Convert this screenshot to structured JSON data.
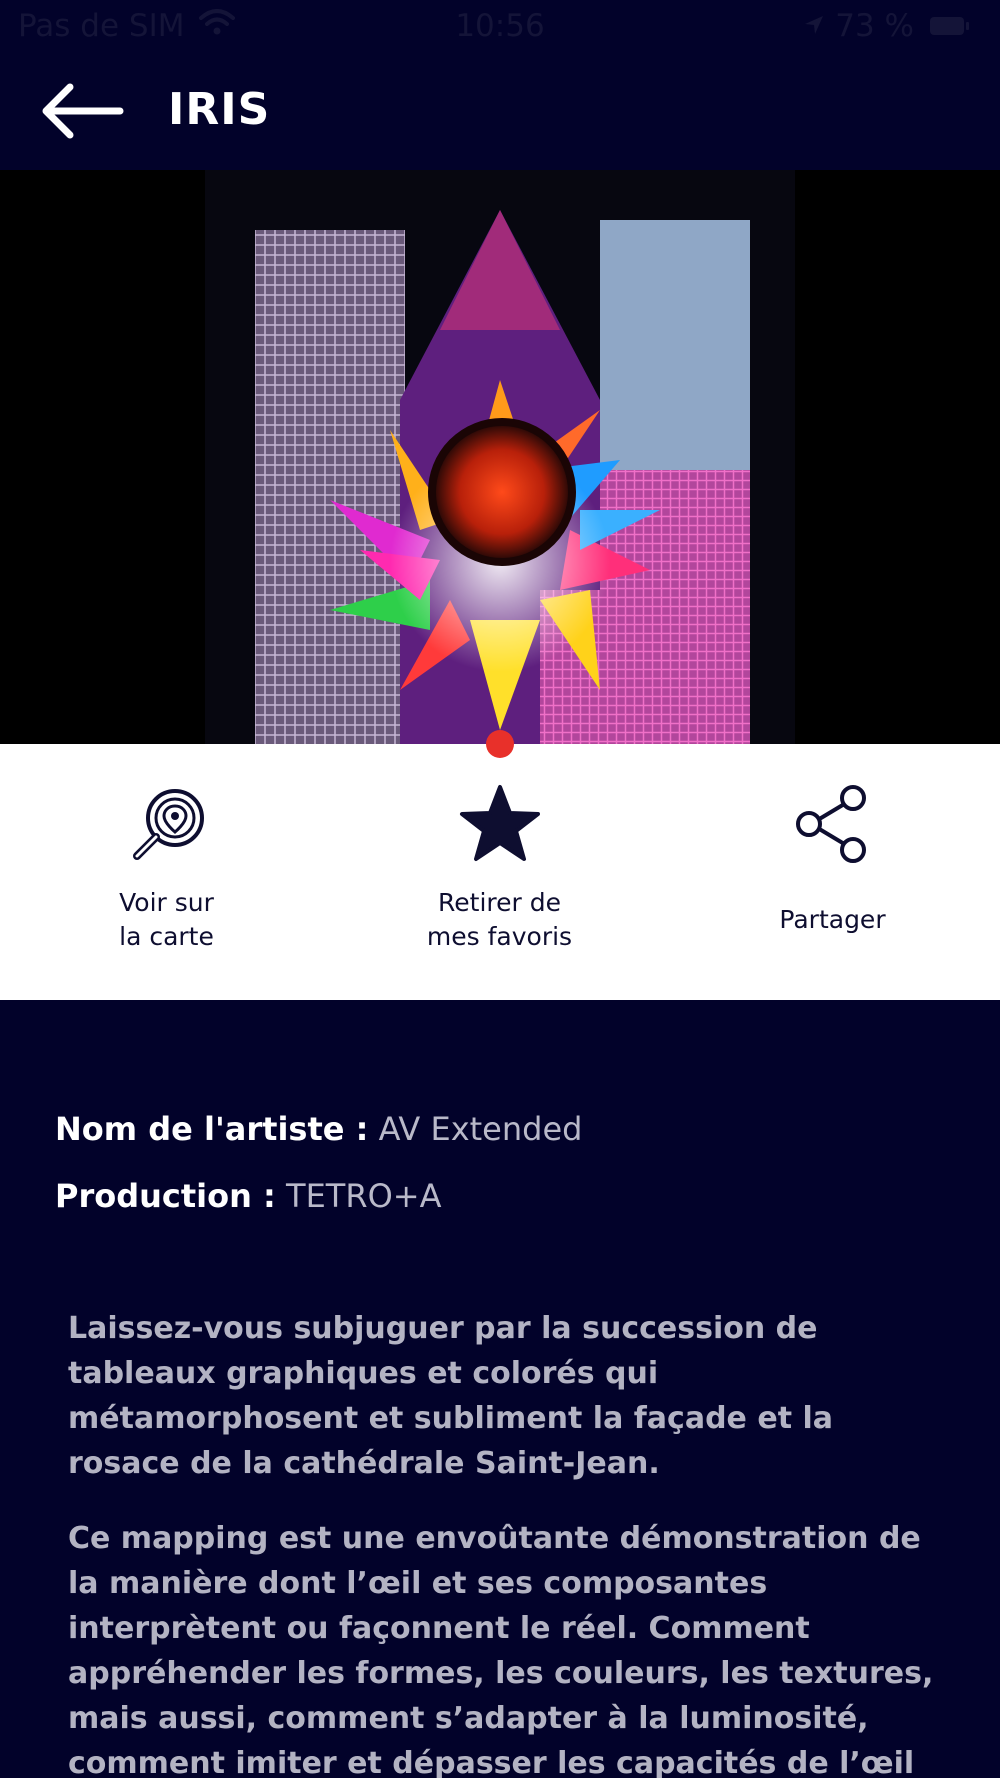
{
  "status_bar": {
    "carrier": "Pas de SIM",
    "time": "10:56",
    "battery": "73 %"
  },
  "nav": {
    "title": "IRIS"
  },
  "actions": [
    {
      "line1": "Voir sur",
      "line2": "la carte",
      "icon": "map-search-icon"
    },
    {
      "line1": "Retirer de",
      "line2": "mes favoris",
      "icon": "star-icon"
    },
    {
      "line1": "Partager",
      "line2": "",
      "icon": "share-icon"
    }
  ],
  "info": {
    "artist_label": "Nom de l'artiste :",
    "artist_value": "AV Extended",
    "production_label": "Production :",
    "production_value": "TETRO+A"
  },
  "description": {
    "p1": "Laissez-vous subjuguer par la succession de tableaux graphiques et colorés qui métamorphosent et subliment la façade et la rosace de la cathédrale Saint-Jean.",
    "p2": "Ce mapping est une envoûtante démonstration de la manière dont l’œil et ses composantes interprètent ou façonnent le réel.  Comment appréhender les formes, les couleurs, les textures, mais aussi, comment s’adapter à la luminosité, comment imiter et dépasser les capacités de l’œil humain, comment"
  },
  "colors": {
    "background": "#02022a",
    "accent_dot": "#e8302a",
    "action_bar": "#ffffff"
  }
}
